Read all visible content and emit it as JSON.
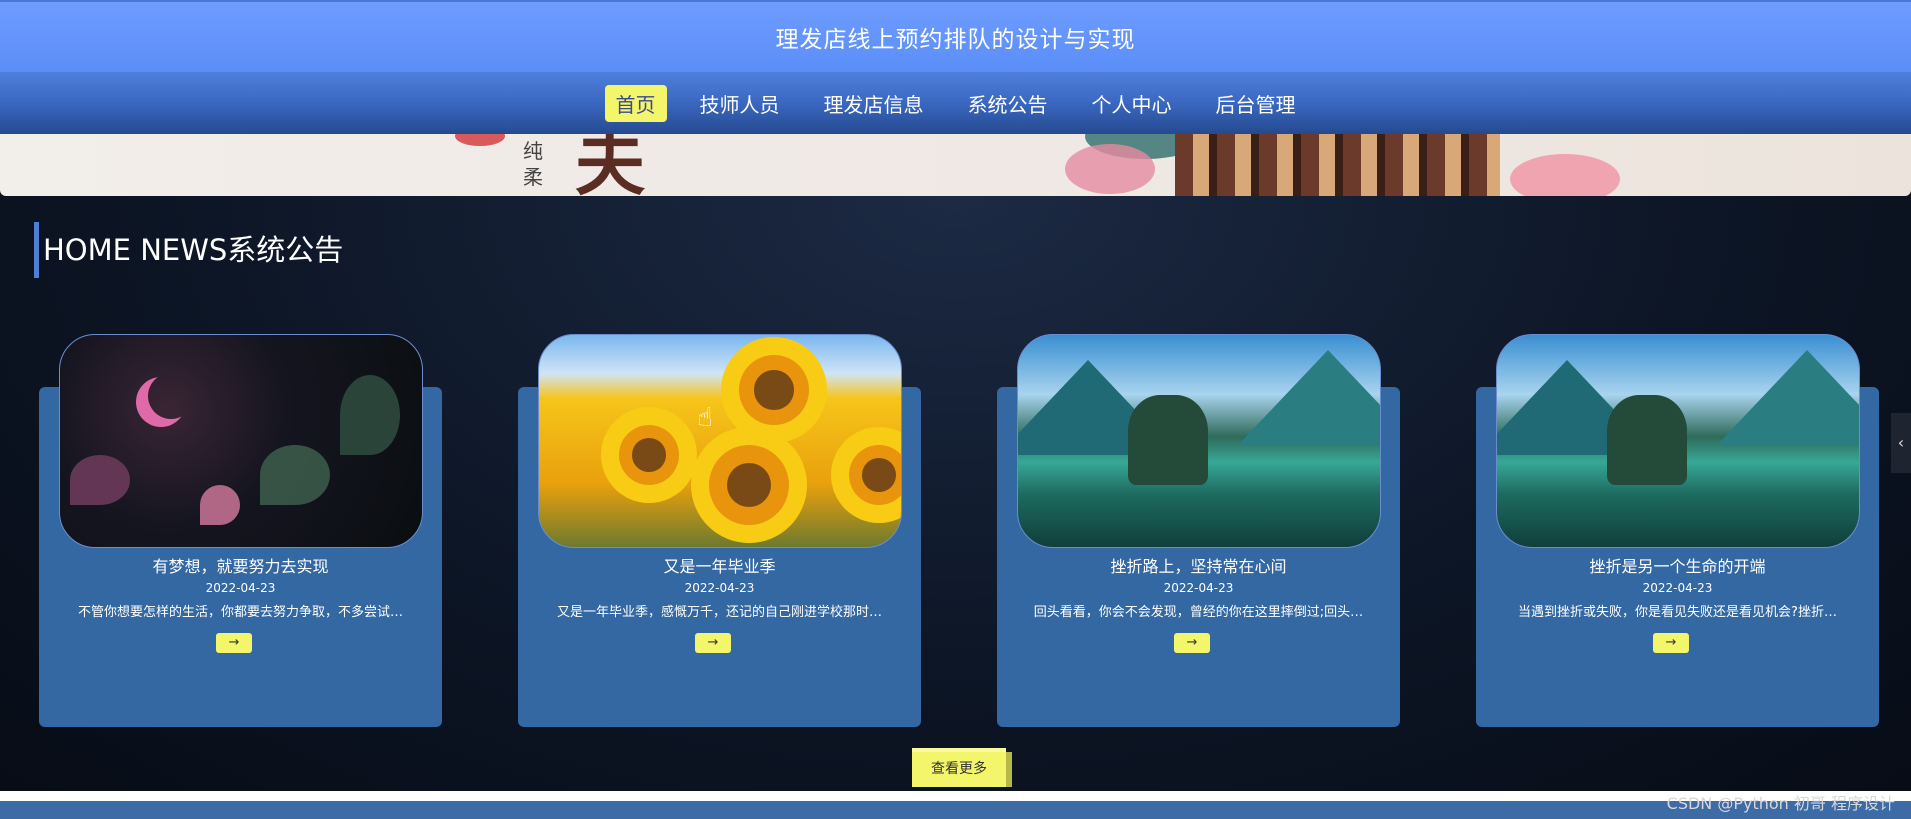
{
  "header": {
    "title": "理发店线上预约排队的设计与实现"
  },
  "nav": {
    "items": [
      {
        "label": "首页",
        "active": true
      },
      {
        "label": "技师人员"
      },
      {
        "label": "理发店信息"
      },
      {
        "label": "系统公告"
      },
      {
        "label": "个人中心"
      },
      {
        "label": "后台管理"
      }
    ]
  },
  "banner": {
    "vertical_text": "纯柔",
    "big_char": "夫"
  },
  "section": {
    "title": "HOME NEWS系统公告"
  },
  "cards": [
    {
      "title": "有梦想，就要努力去实现",
      "date": "2022-04-23",
      "summary": "不管你想要怎样的生活，你都要去努力争取，不多尝试…",
      "button": "→",
      "image": "night-garden"
    },
    {
      "title": "又是一年毕业季",
      "date": "2022-04-23",
      "summary": "又是一年毕业季，感慨万千，还记的自己刚进学校那时…",
      "button": "→",
      "image": "sunflowers"
    },
    {
      "title": "挫折路上，坚持常在心间",
      "date": "2022-04-23",
      "summary": "回头看看，你会不会发现，曾经的你在这里摔倒过;回头…",
      "button": "→",
      "image": "mountain-lake"
    },
    {
      "title": "挫折是另一个生命的开端",
      "date": "2022-04-23",
      "summary": "当遇到挫折或失败，你是看见失败还是看见机会?挫折…",
      "button": "→",
      "image": "mountain-lake"
    }
  ],
  "more_button": "查看更多",
  "side_tab": "‹",
  "watermark": "CSDN @Python 初哥 程序设计",
  "colors": {
    "header": "#6e9cff",
    "nav": "#3a67c0",
    "accent": "#f3f56a",
    "card": "#3368a3"
  }
}
